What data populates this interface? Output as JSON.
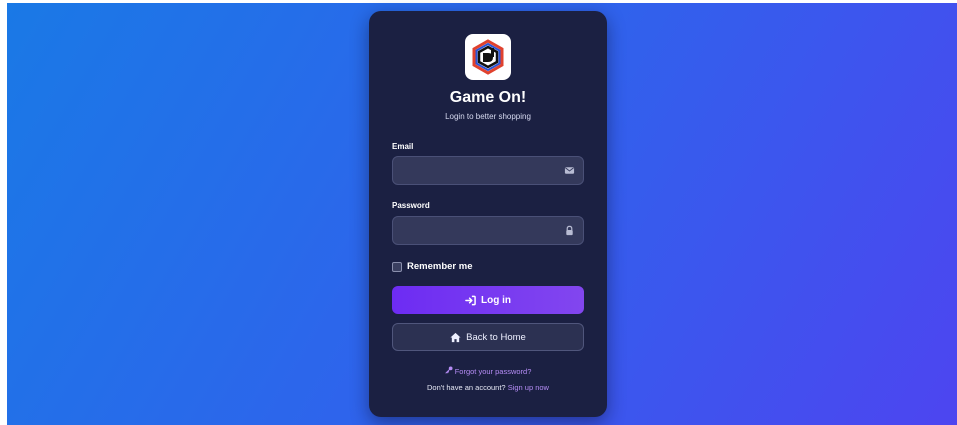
{
  "brand": {
    "title": "Game On!",
    "subtitle": "Login to better shopping",
    "logo_icon": "hexagon-d-logo"
  },
  "form": {
    "email_label": "Email",
    "email_value": "",
    "email_icon": "envelope-icon",
    "password_label": "Password",
    "password_value": "",
    "password_icon": "lock-icon",
    "remember_label": "Remember me",
    "remember_checked": false
  },
  "actions": {
    "login_label": "Log in",
    "login_icon": "sign-in-icon",
    "home_label": "Back to Home",
    "home_icon": "home-icon"
  },
  "footer": {
    "forgot_label": "Forgot your password?",
    "forgot_icon": "key-icon",
    "no_account_text": "Don't have an account?",
    "signup_label": "Sign up now"
  },
  "colors": {
    "background_start": "#1a79e6",
    "background_end": "#4d45f0",
    "card": "#1b2042",
    "accent": "#7b3ff2",
    "link": "#b58cf5"
  }
}
